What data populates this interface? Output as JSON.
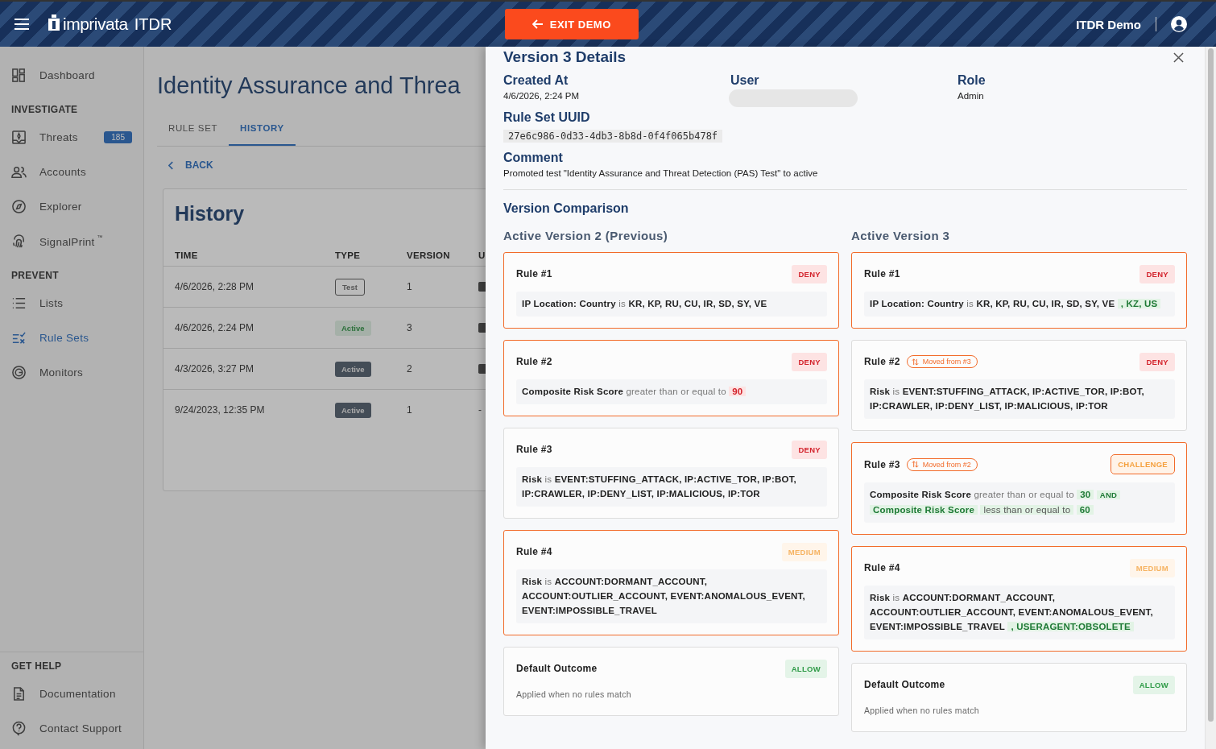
{
  "header": {
    "logo": "imprivata",
    "product": "ITDR",
    "exit_button": "EXIT DEMO",
    "tenant": "ITDR Demo"
  },
  "sidebar": {
    "sections": [
      {
        "items": [
          {
            "label": "Dashboard",
            "selected": false
          }
        ]
      },
      {
        "heading": "INVESTIGATE",
        "items": [
          {
            "label": "Threats",
            "badge": "185",
            "selected": false
          },
          {
            "label": "Accounts",
            "selected": false
          },
          {
            "label": "Explorer",
            "selected": false
          },
          {
            "label": "SignalPrint",
            "mark": "™",
            "selected": false
          }
        ]
      },
      {
        "heading": "PREVENT",
        "items": [
          {
            "label": "Lists",
            "selected": false
          },
          {
            "label": "Rule Sets",
            "selected": true
          },
          {
            "label": "Monitors",
            "selected": false
          }
        ]
      }
    ],
    "help": {
      "heading": "GET HELP",
      "items": [
        {
          "label": "Documentation",
          "selected": false
        },
        {
          "label": "Contact Support",
          "selected": false
        }
      ]
    }
  },
  "page": {
    "title": "Identity Assurance and Threa",
    "tabs": [
      {
        "label": "RULE SET",
        "selected": false
      },
      {
        "label": "HISTORY",
        "selected": true
      }
    ],
    "back": "BACK",
    "history": {
      "title": "History",
      "columns": [
        "TIME",
        "TYPE",
        "VERSION",
        "U"
      ],
      "rows": [
        {
          "time": "4/6/2026, 2:28 PM",
          "type": {
            "label": "Test",
            "kind": "outline"
          },
          "version": "1",
          "avatar": true
        },
        {
          "time": "4/6/2026, 2:24 PM",
          "type": {
            "label": "Active",
            "kind": "success"
          },
          "version": "3",
          "avatar": true
        },
        {
          "time": "4/3/2026, 3:27 PM",
          "type": {
            "label": "Active",
            "kind": "dark"
          },
          "version": "2",
          "avatar": true
        },
        {
          "time": "9/24/2023, 12:35 PM",
          "type": {
            "label": "Active",
            "kind": "dark"
          },
          "version": "1",
          "avatar": false,
          "column_4": "-"
        }
      ]
    }
  },
  "drawer": {
    "title": "Version 3 Details",
    "meta": [
      {
        "label": "Created At",
        "value": "4/6/2026, 2:24 PM"
      },
      {
        "label": "User",
        "redacted": true
      },
      {
        "label": "Role",
        "value": "Admin"
      }
    ],
    "uuid_label": "Rule Set UUID",
    "uuid": "27e6c986-0d33-4db3-8b8d-0f4f065b478f",
    "comment_label": "Comment",
    "comment": "Promoted test \"Identity Assurance and Threat Detection (PAS) Test\" to active",
    "comparison_title": "Version Comparison",
    "columns": [
      {
        "heading": "Active Version 2 (Previous)",
        "cards": [
          {
            "title": "Rule #1",
            "changed": true,
            "outcome": {
              "label": "DENY",
              "kind": "deny"
            },
            "parts": [
              {
                "text": "IP Location: Country",
                "kind": "field"
              },
              {
                "text": "is",
                "kind": "op"
              },
              {
                "text": "KR, KP, RU, CU, IR, SD, SY, VE",
                "kind": "value"
              }
            ]
          },
          {
            "title": "Rule #2",
            "changed": true,
            "outcome": {
              "label": "DENY",
              "kind": "deny"
            },
            "parts": [
              {
                "text": "Composite Risk Score",
                "kind": "field"
              },
              {
                "text": "greater than or equal to",
                "kind": "op"
              },
              {
                "text": "90",
                "kind": "removed"
              }
            ]
          },
          {
            "title": "Rule #3",
            "changed": false,
            "outcome": {
              "label": "DENY",
              "kind": "deny"
            },
            "parts": [
              {
                "text": "Risk",
                "kind": "field"
              },
              {
                "text": "is",
                "kind": "op"
              },
              {
                "text": "EVENT:STUFFING_ATTACK, IP:ACTIVE_TOR, IP:BOT, IP:CRAWLER, IP:DENY_LIST, IP:MALICIOUS, IP:TOR",
                "kind": "value"
              }
            ]
          },
          {
            "title": "Rule #4",
            "changed": true,
            "outcome": {
              "label": "MEDIUM",
              "kind": "medium"
            },
            "parts": [
              {
                "text": "Risk",
                "kind": "field"
              },
              {
                "text": "is",
                "kind": "op"
              },
              {
                "text": "ACCOUNT:DORMANT_ACCOUNT, ACCOUNT:OUTLIER_ACCOUNT, EVENT:ANOMALOUS_EVENT, EVENT:IMPOSSIBLE_TRAVEL",
                "kind": "value"
              }
            ]
          },
          {
            "title": "Default Outcome",
            "changed": false,
            "outcome": {
              "label": "ALLOW",
              "kind": "allow"
            },
            "description": "Applied when no rules match"
          }
        ]
      },
      {
        "heading": "Active Version 3",
        "cards": [
          {
            "title": "Rule #1",
            "changed": true,
            "outcome": {
              "label": "DENY",
              "kind": "deny"
            },
            "parts": [
              {
                "text": "IP Location: Country",
                "kind": "field"
              },
              {
                "text": "is",
                "kind": "op"
              },
              {
                "text": "KR, KP, RU, CU, IR, SD, SY, VE",
                "kind": "value"
              },
              {
                "text": ", KZ, US",
                "kind": "added"
              }
            ]
          },
          {
            "title": "Rule #2",
            "changed": false,
            "moved": "Moved from #3",
            "outcome": {
              "label": "DENY",
              "kind": "deny"
            },
            "parts": [
              {
                "text": "Risk",
                "kind": "field"
              },
              {
                "text": "is",
                "kind": "op"
              },
              {
                "text": "EVENT:STUFFING_ATTACK, IP:ACTIVE_TOR, IP:BOT, IP:CRAWLER, IP:DENY_LIST, IP:MALICIOUS, IP:TOR",
                "kind": "value"
              }
            ]
          },
          {
            "title": "Rule #3",
            "changed": true,
            "moved": "Moved from #2",
            "outcome": {
              "label": "CHALLENGE",
              "kind": "challenge"
            },
            "parts": [
              {
                "text": "Composite Risk Score",
                "kind": "field"
              },
              {
                "text": "greater than or equal to",
                "kind": "op"
              },
              {
                "text": "30",
                "kind": "added"
              },
              {
                "text": "AND",
                "kind": "added_connector"
              },
              {
                "text": "Composite Risk Score",
                "kind": "added"
              },
              {
                "text": "less than or equal to",
                "kind": "added_op"
              },
              {
                "text": "60",
                "kind": "added"
              }
            ]
          },
          {
            "title": "Rule #4",
            "changed": true,
            "outcome": {
              "label": "MEDIUM",
              "kind": "medium"
            },
            "parts": [
              {
                "text": "Risk",
                "kind": "field"
              },
              {
                "text": "is",
                "kind": "op"
              },
              {
                "text": "ACCOUNT:DORMANT_ACCOUNT, ACCOUNT:OUTLIER_ACCOUNT, EVENT:ANOMALOUS_EVENT, EVENT:IMPOSSIBLE_TRAVEL",
                "kind": "value"
              },
              {
                "text": ", USERAGENT:OBSOLETE",
                "kind": "added"
              }
            ]
          },
          {
            "title": "Default Outcome",
            "changed": false,
            "outcome": {
              "label": "ALLOW",
              "kind": "allow"
            },
            "description": "Applied when no rules match"
          }
        ]
      }
    ]
  }
}
